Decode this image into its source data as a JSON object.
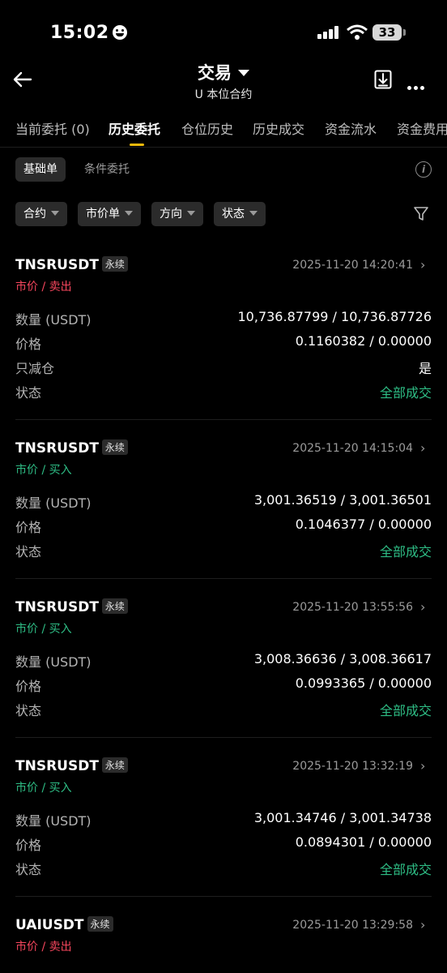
{
  "status_bar": {
    "time": "15:02",
    "battery": "33"
  },
  "header": {
    "title": "交易",
    "subtitle": "U 本位合约"
  },
  "tabs": [
    "当前委托 (0)",
    "历史委托",
    "仓位历史",
    "历史成交",
    "资金流水",
    "资金费用"
  ],
  "active_tab": "历史委托",
  "subtabs": {
    "basic": "基础单",
    "conditional": "条件委托"
  },
  "filters": [
    "合约",
    "市价单",
    "方向",
    "状态"
  ],
  "labels": {
    "qty": "数量 (USDT)",
    "price": "价格",
    "reduce_only": "只减仓",
    "status": "状态",
    "perp": "永续"
  },
  "orders": [
    {
      "symbol": "TNSRUSDT",
      "time": "2025-11-20 14:20:41",
      "side": "市价 / 卖出",
      "qty": "10,736.87799 / 10,736.87726",
      "price": "0.1160382 / 0.00000",
      "reduce_only": "是",
      "status": "全部成交"
    },
    {
      "symbol": "TNSRUSDT",
      "time": "2025-11-20 14:15:04",
      "side": "市价 / 买入",
      "qty": "3,001.36519 / 3,001.36501",
      "price": "0.1046377 / 0.00000",
      "status": "全部成交"
    },
    {
      "symbol": "TNSRUSDT",
      "time": "2025-11-20 13:55:56",
      "side": "市价 / 买入",
      "qty": "3,008.36636 / 3,008.36617",
      "price": "0.0993365 / 0.00000",
      "status": "全部成交"
    },
    {
      "symbol": "TNSRUSDT",
      "time": "2025-11-20 13:32:19",
      "side": "市价 / 买入",
      "qty": "3,001.34746 / 3,001.34738",
      "price": "0.0894301 / 0.00000",
      "status": "全部成交"
    },
    {
      "symbol": "UAIUSDT",
      "time": "2025-11-20 13:29:58",
      "side": "市价 / 卖出"
    }
  ],
  "colors": {
    "sell": "#f6465d",
    "buy": "#2ebd85",
    "accent": "#f0b90b"
  },
  "icons": [
    "back-arrow-icon",
    "caret-down-icon",
    "download-icon",
    "more-icon",
    "info-icon",
    "filter-funnel-icon",
    "chevron-right-icon"
  ]
}
